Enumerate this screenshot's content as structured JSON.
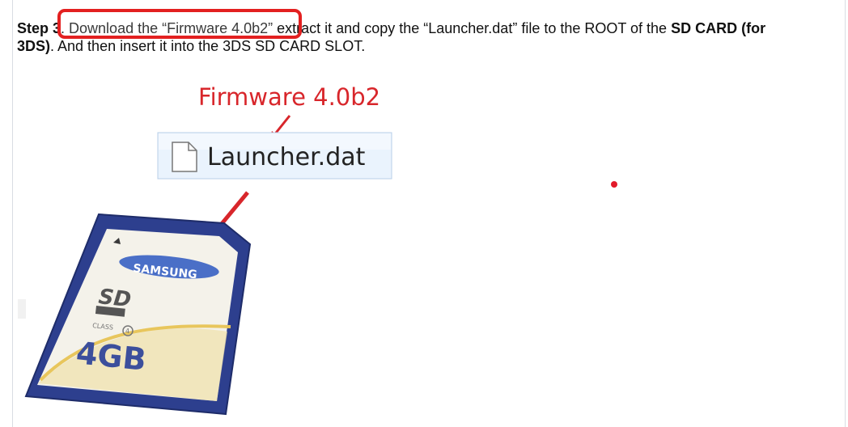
{
  "instruction": {
    "step_prefix": "Step ",
    "step_number": "3",
    "link_text": ". Download the “Firmware 4.0b2”",
    "middle_text": " extract it and copy the “Launcher.dat” file to the ROOT of the ",
    "bold_target": "SD CARD (for",
    "bold_target_2": "3DS)",
    "tail_text": ". And then insert it into the 3DS SD CARD SLOT."
  },
  "illustration": {
    "folder_caption": "Firmware 4.0b2",
    "file_name": "Launcher.dat",
    "card_brand": "SAMSUNG",
    "card_capacity": "4GB",
    "card_class_label": "CLASS",
    "card_class_number": "4",
    "card_logo_text": "SD"
  },
  "colors": {
    "highlight": "#e32020",
    "card_body": "#2d3f8e",
    "card_label": "#ffffff",
    "caption_red": "#d8262b"
  }
}
